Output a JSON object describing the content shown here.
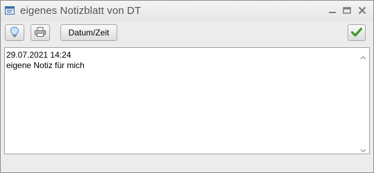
{
  "window": {
    "title": "eigenes Notizblatt von DT",
    "app_icon": "notepad-window-icon",
    "controls": {
      "minimize_icon": "minimize-icon",
      "maximize_icon": "maximize-icon",
      "close_icon": "close-icon"
    }
  },
  "toolbar": {
    "buttons": [
      {
        "icon": "lightbulb-icon"
      },
      {
        "icon": "printer-icon"
      },
      {
        "label": "Datum/Zeit"
      },
      {
        "icon": "checkmark-icon"
      }
    ]
  },
  "editor": {
    "content": "29.07.2021 14:24\neigene Notiz für mich"
  },
  "colors": {
    "check_green": "#3f9a2a",
    "bulb_blue": "#4c8fd0",
    "title_text": "#555555"
  }
}
